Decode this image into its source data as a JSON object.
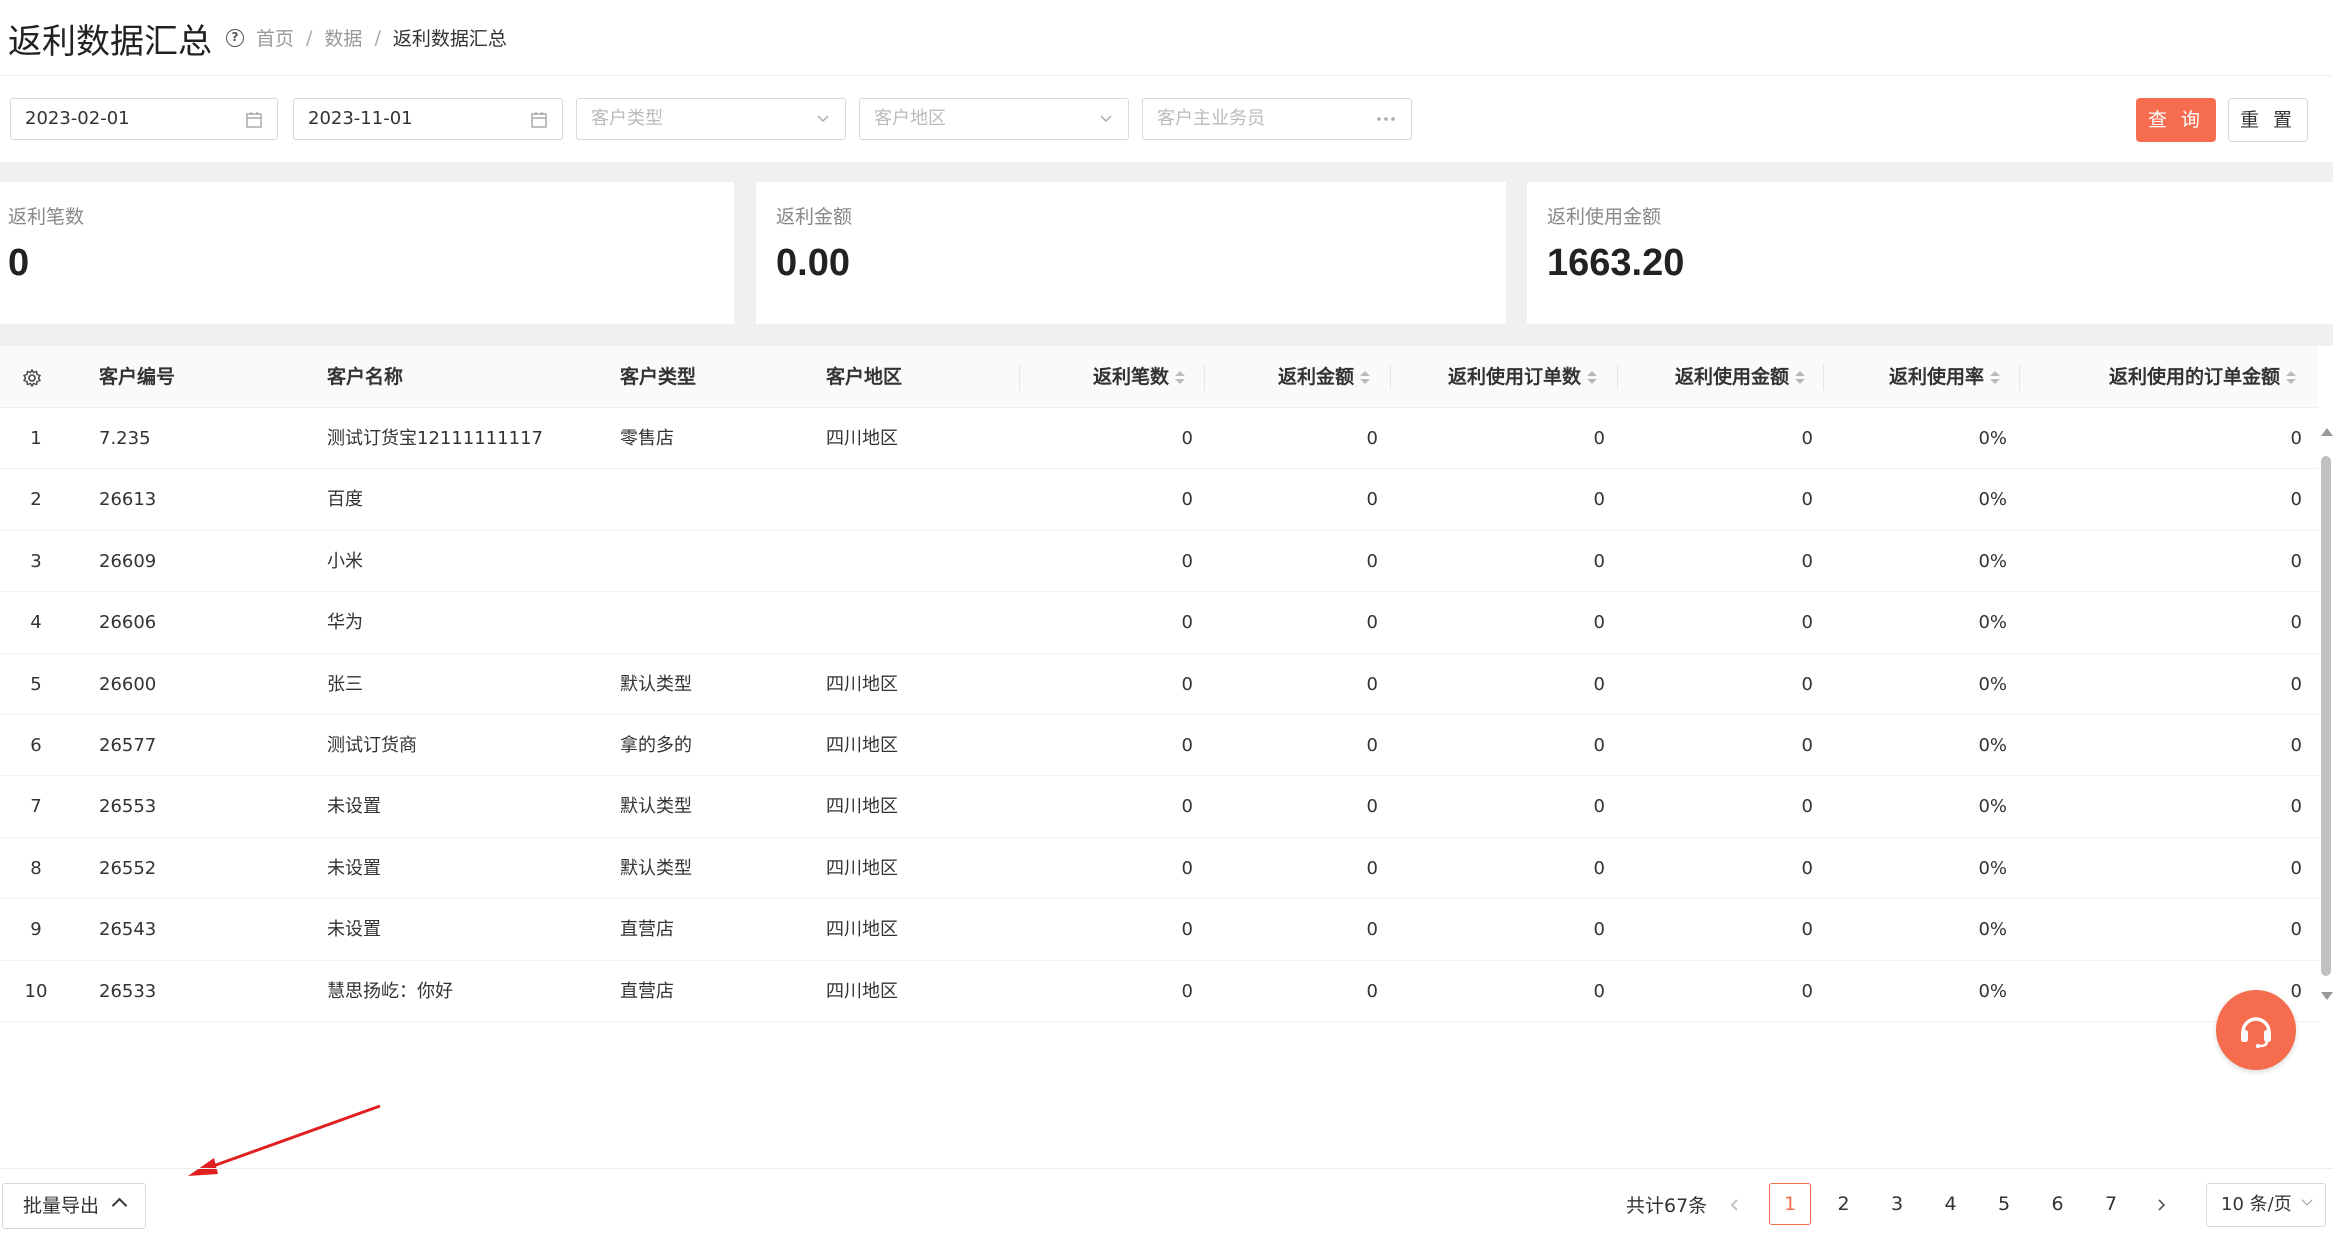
{
  "header": {
    "title": "返利数据汇总",
    "breadcrumb": [
      "首页",
      "数据",
      "返利数据汇总"
    ]
  },
  "filters": {
    "start_date": "2023-02-01",
    "end_date": "2023-11-01",
    "customer_type_placeholder": "客户类型",
    "customer_region_placeholder": "客户地区",
    "salesperson_placeholder": "客户主业务员",
    "query_label": "查 询",
    "reset_label": "重 置"
  },
  "stats": [
    {
      "label": "返利笔数",
      "value": "0"
    },
    {
      "label": "返利金额",
      "value": "0.00"
    },
    {
      "label": "返利使用金额",
      "value": "1663.20"
    }
  ],
  "table": {
    "columns": [
      "客户编号",
      "客户名称",
      "客户类型",
      "客户地区",
      "返利笔数",
      "返利金额",
      "返利使用订单数",
      "返利使用金额",
      "返利使用率",
      "返利使用的订单金额"
    ],
    "rows": [
      [
        "1",
        "7.235",
        "测试订货宝12111111117",
        "零售店",
        "四川地区",
        "0",
        "0",
        "0",
        "0",
        "0%",
        "0"
      ],
      [
        "2",
        "26613",
        "百度",
        "",
        "",
        "0",
        "0",
        "0",
        "0",
        "0%",
        "0"
      ],
      [
        "3",
        "26609",
        "小米",
        "",
        "",
        "0",
        "0",
        "0",
        "0",
        "0%",
        "0"
      ],
      [
        "4",
        "26606",
        "华为",
        "",
        "",
        "0",
        "0",
        "0",
        "0",
        "0%",
        "0"
      ],
      [
        "5",
        "26600",
        "张三",
        "默认类型",
        "四川地区",
        "0",
        "0",
        "0",
        "0",
        "0%",
        "0"
      ],
      [
        "6",
        "26577",
        "测试订货商",
        "拿的多的",
        "四川地区",
        "0",
        "0",
        "0",
        "0",
        "0%",
        "0"
      ],
      [
        "7",
        "26553",
        "未设置",
        "默认类型",
        "四川地区",
        "0",
        "0",
        "0",
        "0",
        "0%",
        "0"
      ],
      [
        "8",
        "26552",
        "未设置",
        "默认类型",
        "四川地区",
        "0",
        "0",
        "0",
        "0",
        "0%",
        "0"
      ],
      [
        "9",
        "26543",
        "未设置",
        "直营店",
        "四川地区",
        "0",
        "0",
        "0",
        "0",
        "0%",
        "0"
      ],
      [
        "10",
        "26533",
        "慧思扬屹：你好",
        "直营店",
        "四川地区",
        "0",
        "0",
        "0",
        "0",
        "0%",
        "0"
      ]
    ]
  },
  "footer": {
    "export_label": "批量导出",
    "total": "共计67条",
    "pages": [
      "1",
      "2",
      "3",
      "4",
      "5",
      "6",
      "7"
    ],
    "current_page": "1",
    "page_size": "10 条/页"
  },
  "colors": {
    "accent": "#f56c4e"
  },
  "icons": [
    "help-icon",
    "calendar-icon",
    "chevron-down-icon",
    "ellipsis-icon",
    "gear-icon",
    "sort-icon",
    "headset-icon",
    "chevron-up-icon",
    "chevron-left-icon",
    "chevron-right-icon"
  ]
}
